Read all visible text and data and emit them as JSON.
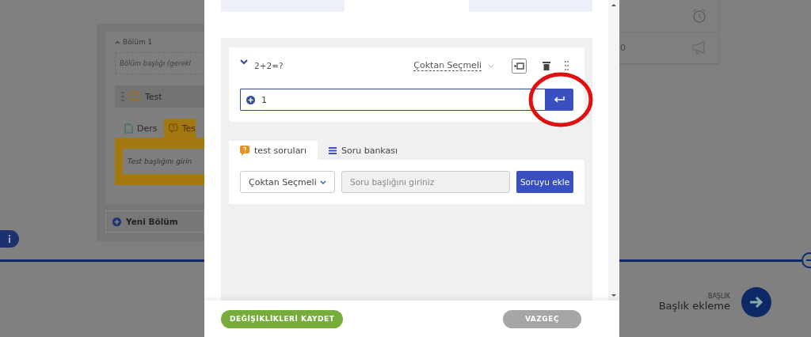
{
  "background": {
    "section": {
      "title": "Bölüm 1",
      "title_placeholder": "Bölüm başlığı (gerekl",
      "item": {
        "label": "Test"
      },
      "tabs": [
        {
          "label": "Ders",
          "selected": false
        },
        {
          "label": "Tes",
          "selected": true
        }
      ],
      "test_title_placeholder": "Test başlığını girin",
      "new_section": "Yeni Bölüm"
    },
    "right_card": {
      "row_2_text": "0"
    },
    "next_step": {
      "caption": "BAŞLIK",
      "title": "Başlık ekleme"
    }
  },
  "modal": {
    "question": {
      "title": "2+2=?",
      "expanded": true,
      "type": "Çoktan Seçmeli",
      "answer_input": {
        "value": "1"
      }
    },
    "bank_tabs": [
      {
        "label": "test soruları",
        "selected": true
      },
      {
        "label": "Soru bankası",
        "selected": false
      }
    ],
    "add_form": {
      "type": "Çoktan Seçmeli",
      "placeholder": "Soru başlığını giriniz",
      "button": "Soruyu ekle"
    },
    "footer": {
      "save": "DEĞİŞİKLİKLERİ KAYDET",
      "cancel": "VAZGEÇ"
    }
  }
}
